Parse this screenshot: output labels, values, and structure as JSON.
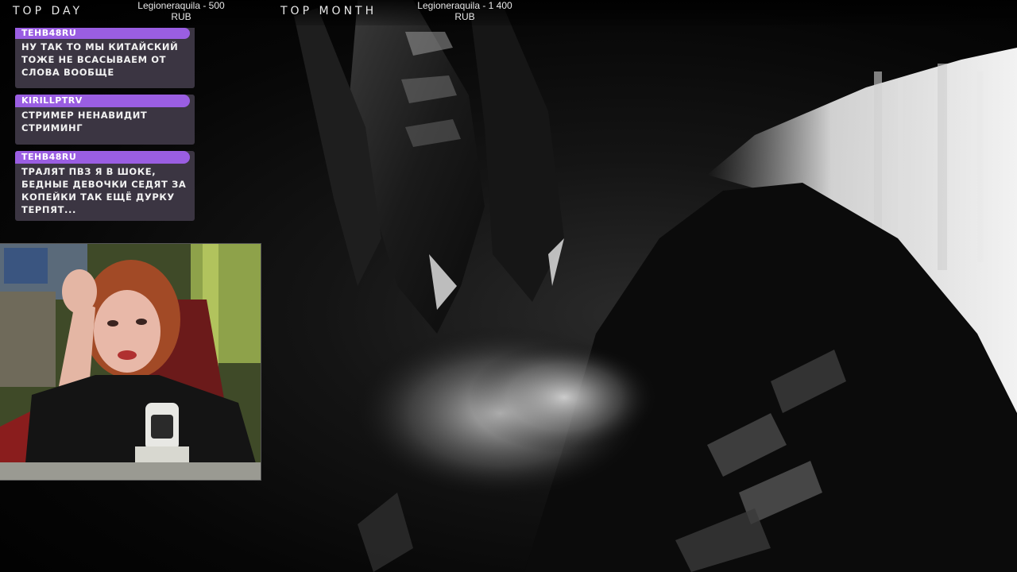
{
  "overlay": {
    "top_day": {
      "label": "TOP DAY",
      "donor_amount": "Legioneraquila - 500",
      "currency": "RUB"
    },
    "top_month": {
      "label": "TOP MONTH",
      "donor_amount": "Legioneraquila - 1 400",
      "currency": "RUB"
    }
  },
  "chat": {
    "messages": [
      {
        "user": "TEHB48RU",
        "text": "НУ ТАК ТО МЫ КИТАЙСКИЙ ТОЖЕ НЕ ВСАСЫВАЕМ ОТ СЛОВА ВООБЩЕ"
      },
      {
        "user": "KIRILLPTRV",
        "text": "СТРИМЕР НЕНАВИДИТ СТРИМИНГ"
      },
      {
        "user": "TEHB48RU",
        "text": "ТРАЛЯТ ПВЗ Я В ШОКЕ, БЕДНЫЕ ДЕВОЧКИ СЕДЯТ ЗА КОПЕЙКИ ТАК ЕЩЁ ДУРКУ ТЕРПЯТ..."
      }
    ]
  },
  "colors": {
    "username_bar": "#9a5ee2",
    "message_bg": "#3b3542",
    "scene_bg": "#000000"
  },
  "icons": {
    "webcam": "streamer-webcam-feed",
    "scene": "dark-armored-knight-artwork"
  }
}
